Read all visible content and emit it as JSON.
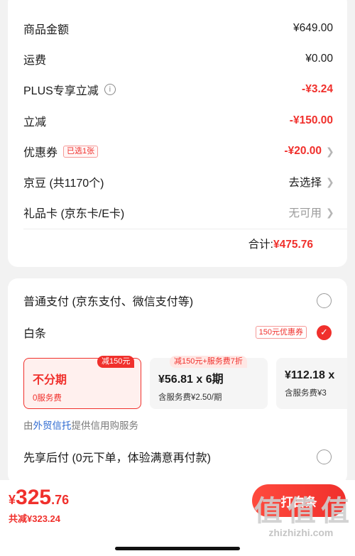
{
  "summary": {
    "goods_amount": {
      "label": "商品金额",
      "value": "¥649.00"
    },
    "shipping": {
      "label": "运费",
      "value": "¥0.00"
    },
    "plus_discount": {
      "label": "PLUS专享立减",
      "value": "-¥3.24"
    },
    "instant_discount": {
      "label": "立减",
      "value": "-¥150.00"
    },
    "coupon": {
      "label": "优惠券",
      "badge": "已选1张",
      "value": "-¥20.00"
    },
    "jingdou": {
      "label": "京豆 (共1170个)",
      "value": "去选择"
    },
    "gift_card": {
      "label": "礼品卡 (京东卡/E卡)",
      "value": "无可用"
    },
    "total_label": "合计:",
    "total_value": "¥475.76"
  },
  "payment": {
    "normal": {
      "label": "普通支付 (京东支付、微信支付等)"
    },
    "baitiao": {
      "label": "白条",
      "promo": "150元优惠券"
    },
    "plans": [
      {
        "main": "不分期",
        "sub": "0服务费",
        "tag": "减150元"
      },
      {
        "main": "¥56.81 x 6期",
        "sub": "含服务费¥2.50/期",
        "tag": "减150元+服务费7折"
      },
      {
        "main": "¥112.18 x",
        "sub": "含服务费¥3"
      }
    ],
    "provider_prefix": "由",
    "provider_link": "外贸信托",
    "provider_suffix": "提供信用购服务",
    "pay_later": {
      "label": "先享后付 (0元下单，体验满意再付款)"
    }
  },
  "bottom": {
    "currency": "¥",
    "price_int": "325",
    "price_dec": ".76",
    "saving": "共减¥323.24",
    "button_label": "打白条"
  },
  "watermark": {
    "logo": "值 值 值",
    "url": "zhizhizhi.com"
  },
  "colors": {
    "accent": "#f0302c",
    "link": "#2e6ad1",
    "background": "#f2f2f2"
  }
}
